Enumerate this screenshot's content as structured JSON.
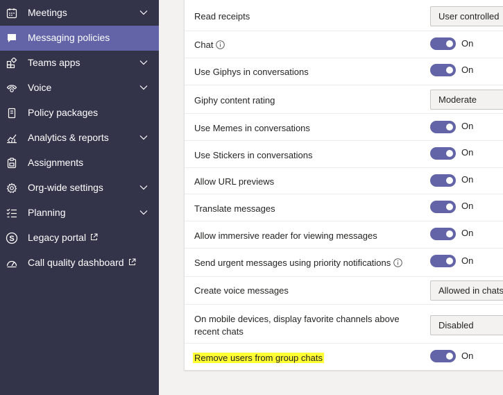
{
  "sidebar": {
    "items": [
      {
        "label": "Meetings",
        "icon": "calendar-icon"
      },
      {
        "label": "Messaging policies",
        "icon": "chat-bubble-icon"
      },
      {
        "label": "Teams apps",
        "icon": "apps-icon"
      },
      {
        "label": "Voice",
        "icon": "voice-icon"
      },
      {
        "label": "Policy packages",
        "icon": "package-icon"
      },
      {
        "label": "Analytics & reports",
        "icon": "chart-icon"
      },
      {
        "label": "Assignments",
        "icon": "clipboard-icon"
      },
      {
        "label": "Org-wide settings",
        "icon": "gear-icon"
      },
      {
        "label": "Planning",
        "icon": "checklist-icon"
      },
      {
        "label": "Legacy portal",
        "icon": "skype-icon"
      },
      {
        "label": "Call quality dashboard",
        "icon": "gauge-icon"
      }
    ]
  },
  "settings": {
    "rows": [
      {
        "label": "Read receipts",
        "control": "dropdown",
        "value": "User controlled"
      },
      {
        "label": "Chat",
        "control": "toggle",
        "value": "On"
      },
      {
        "label": "Use Giphys in conversations",
        "control": "toggle",
        "value": "On"
      },
      {
        "label": "Giphy content rating",
        "control": "dropdown",
        "value": "Moderate"
      },
      {
        "label": "Use Memes in conversations",
        "control": "toggle",
        "value": "On"
      },
      {
        "label": "Use Stickers in conversations",
        "control": "toggle",
        "value": "On"
      },
      {
        "label": "Allow URL previews",
        "control": "toggle",
        "value": "On"
      },
      {
        "label": "Translate messages",
        "control": "toggle",
        "value": "On"
      },
      {
        "label": "Allow immersive reader for viewing messages",
        "control": "toggle",
        "value": "On"
      },
      {
        "label": "Send urgent messages using priority notifications",
        "control": "toggle",
        "value": "On"
      },
      {
        "label": "Create voice messages",
        "control": "dropdown",
        "value": "Allowed in chats"
      },
      {
        "label": "On mobile devices, display favorite channels above recent chats",
        "control": "dropdown",
        "value": "Disabled"
      },
      {
        "label": "Remove users from group chats",
        "control": "toggle",
        "value": "On"
      }
    ]
  },
  "colors": {
    "sidebar_bg": "#33344a",
    "accent": "#6264a7",
    "highlight": "#ffff33"
  }
}
